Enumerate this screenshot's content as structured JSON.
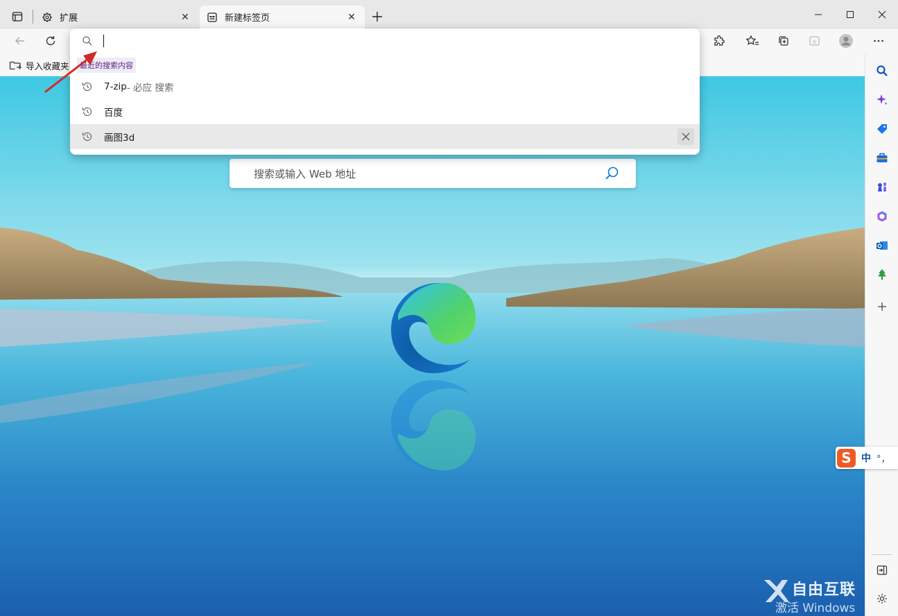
{
  "tabs": [
    {
      "label": "扩展",
      "icon": "puzzle-gear-icon",
      "active": false
    },
    {
      "label": "新建标签页",
      "icon": "new-tab-page-icon",
      "active": true
    }
  ],
  "omnibox": {
    "value": "",
    "section_header": "最近的搜索内容",
    "suggestions": [
      {
        "text": "7-zip",
        "suffix": " - 必应 搜索"
      },
      {
        "text": "百度",
        "suffix": ""
      },
      {
        "text": "画图3d",
        "suffix": ""
      }
    ]
  },
  "favorites": {
    "import_label": "导入收藏夹"
  },
  "page": {
    "search_placeholder": "搜索或输入 Web 地址"
  },
  "ime": {
    "label": "中",
    "punct": "°，"
  },
  "watermark": {
    "brand": "自由互联",
    "text": "激活 Windows"
  },
  "colors": {
    "accent": "#0078d4",
    "highlight_row": "#e9e9e9",
    "annotation_arrow": "#d12a26"
  }
}
